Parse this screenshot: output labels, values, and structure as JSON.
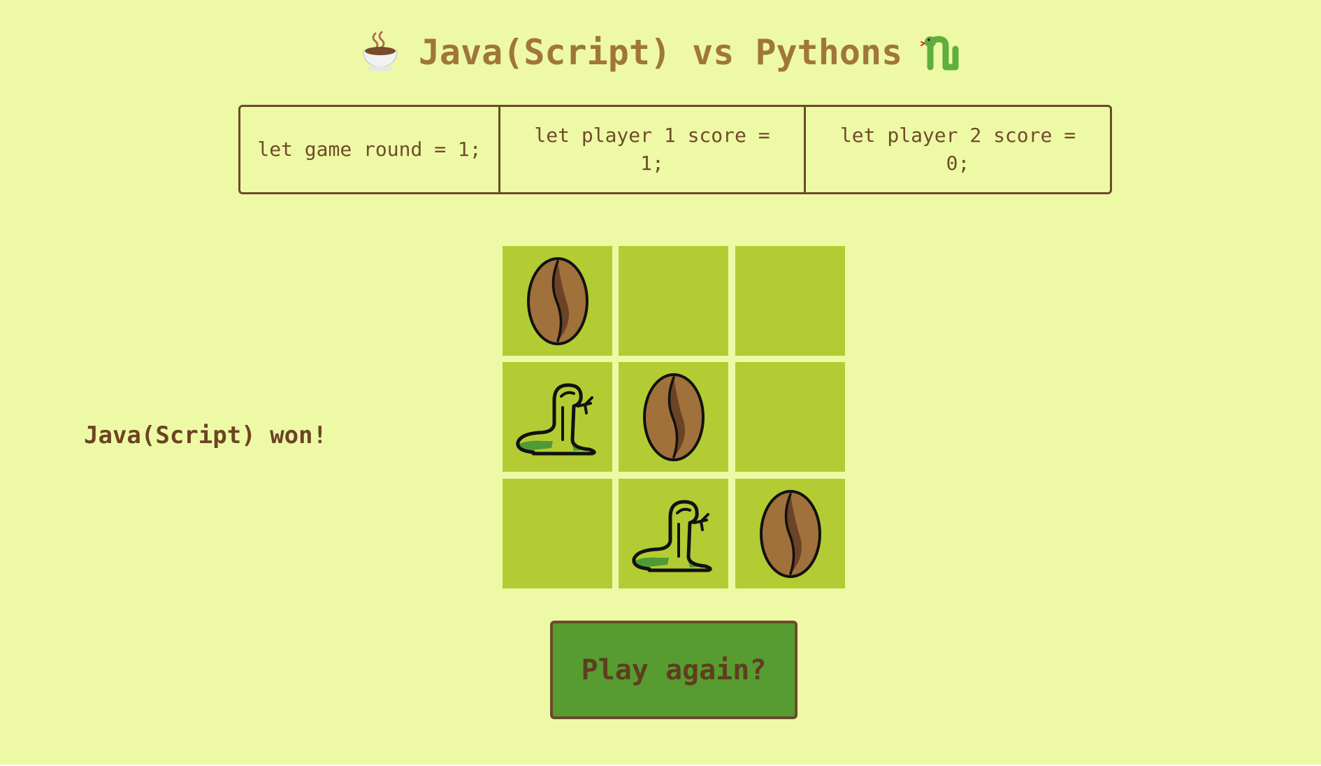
{
  "header": {
    "title": "Java(Script) vs Pythons",
    "left_icon": "hot-beverage-icon",
    "right_icon": "snake-icon"
  },
  "scoreboard": {
    "round": "let game round = 1;",
    "player1": "let player 1 score = 1;",
    "player2": "let player 2 score = 0;"
  },
  "status": "Java(Script) won!",
  "board": {
    "cells": [
      "bean",
      "",
      "",
      "snake",
      "bean",
      "",
      "",
      "snake",
      "bean"
    ]
  },
  "play_again_label": "Play again?",
  "colors": {
    "background": "#eef9a5",
    "cell": "#b3cc33",
    "button": "#579c30",
    "text_brown": "#6b4423",
    "title_brown": "#a0763a"
  }
}
